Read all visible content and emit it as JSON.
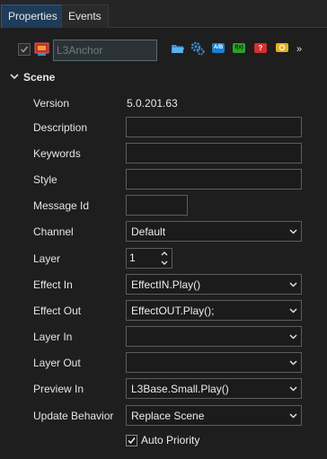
{
  "tabs": [
    {
      "label": "Properties",
      "active": true
    },
    {
      "label": "Events",
      "active": false
    }
  ],
  "toolbar": {
    "name_placeholder": "L3Anchor",
    "buttons": [
      {
        "icon": "open-folder-icon",
        "color": "#4aa3e0"
      },
      {
        "icon": "gears-icon",
        "color": "#3d8fd6"
      },
      {
        "icon": "ab-icon",
        "text": "A/B",
        "color": "#1a7fd4"
      },
      {
        "icon": "function-icon",
        "text": "f(x)",
        "color": "#2aa52a"
      },
      {
        "icon": "help-icon",
        "text": "?",
        "color": "#d43030"
      },
      {
        "icon": "comment-icon",
        "color": "#e0b020"
      }
    ],
    "more_label": "»"
  },
  "section": {
    "title": "Scene"
  },
  "fields": {
    "version": {
      "label": "Version",
      "value": "5.0.201.63"
    },
    "description": {
      "label": "Description",
      "value": ""
    },
    "keywords": {
      "label": "Keywords",
      "value": ""
    },
    "style": {
      "label": "Style",
      "value": ""
    },
    "message_id": {
      "label": "Message Id",
      "value": ""
    },
    "channel": {
      "label": "Channel",
      "value": "Default"
    },
    "layer": {
      "label": "Layer",
      "value": "1"
    },
    "effect_in": {
      "label": "Effect In",
      "value": "EffectIN.Play()"
    },
    "effect_out": {
      "label": "Effect Out",
      "value": "EffectOUT.Play();"
    },
    "layer_in": {
      "label": "Layer In",
      "value": ""
    },
    "layer_out": {
      "label": "Layer Out",
      "value": ""
    },
    "preview_in": {
      "label": "Preview In",
      "value": "L3Base.Small.Play()"
    },
    "update_behavior": {
      "label": "Update Behavior",
      "value": "Replace Scene"
    }
  },
  "auto_priority": {
    "label": "Auto Priority",
    "checked": true
  },
  "colors": {
    "background": "#1e1e1e",
    "tab_active": "#1f3b5a",
    "field_border": "#5c5c5c"
  }
}
